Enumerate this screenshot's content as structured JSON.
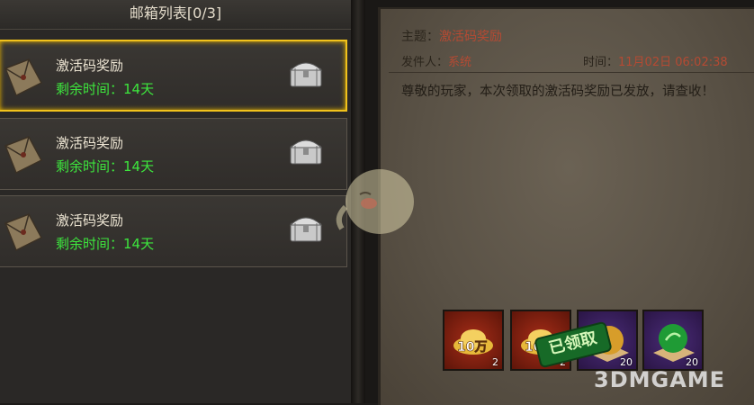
{
  "mailbox": {
    "title": "邮箱列表[0/3]",
    "items": [
      {
        "title": "激活码奖励",
        "time_left": "剩余时间：14天",
        "selected": true
      },
      {
        "title": "激活码奖励",
        "time_left": "剩余时间：14天",
        "selected": false
      },
      {
        "title": "激活码奖励",
        "time_left": "剩余时间：14天",
        "selected": false
      }
    ]
  },
  "detail": {
    "subject_label": "主题：",
    "subject": "激活码奖励",
    "sender_label": "发件人：",
    "sender": "系统",
    "time_label": "时间：",
    "time_date": "11月02日",
    "time_clock": "06:02:38",
    "body": "尊敬的玩家，本次领取的激活码奖励已发放，请查收！"
  },
  "rewards": [
    {
      "icon": "gold-ingot-icon",
      "label": "10万",
      "count": "2",
      "color": "#a62d18"
    },
    {
      "icon": "gold-ingot-icon",
      "label": "10万",
      "count": "2",
      "color": "#a62d18"
    },
    {
      "icon": "gold-orb-icon",
      "count": "20",
      "color": "#4a2c78"
    },
    {
      "icon": "green-orb-icon",
      "count": "20",
      "color": "#4a2c78"
    }
  ],
  "claimed_stamp": "已领取",
  "watermark": "3DMGAME",
  "colors": {
    "selected_border": "#f1c21c",
    "time_green": "#3de63d",
    "accent_red": "#b54a33"
  }
}
